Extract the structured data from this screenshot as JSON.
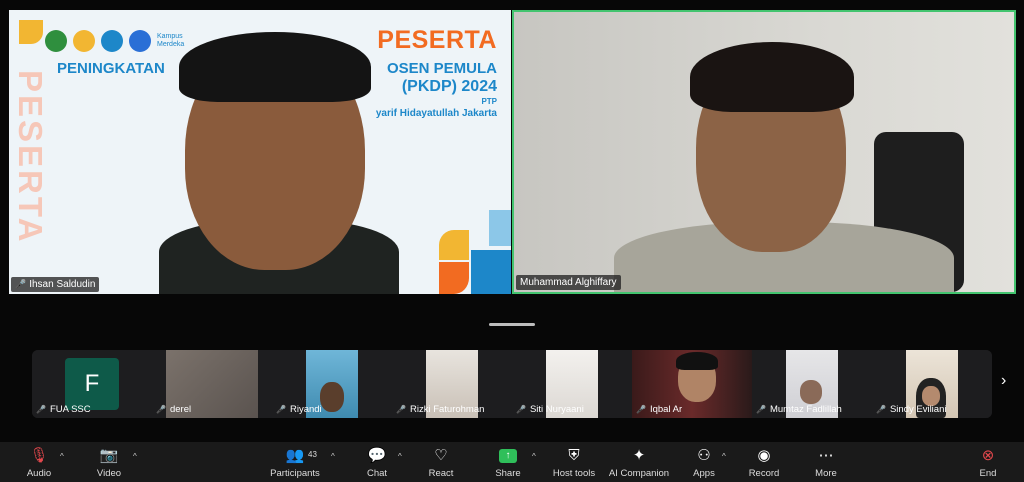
{
  "tiles": [
    {
      "name": "Ihsan Saldudin",
      "muted": true
    },
    {
      "name": "Muhammad Alghiffary",
      "muted": false
    }
  ],
  "slide": {
    "title": "PESERTA",
    "line1": "PENINGKATAN",
    "line1b": "OSEN PEMULA",
    "line2": "(PKDP) 2024",
    "line3": "PTP",
    "line4": "yarif Hidayatullah Jakarta",
    "vertical": "PESERTA",
    "logo_text": "Kampus Merdeka"
  },
  "thumbnails": [
    {
      "name": "FUA SSC",
      "avatar_letter": "F"
    },
    {
      "name": "derel"
    },
    {
      "name": "Riyandi"
    },
    {
      "name": "Rizki Faturohman"
    },
    {
      "name": "Siti Nuryaani"
    },
    {
      "name": "Iqbal Ar"
    },
    {
      "name": "Mumtaz Fadlillah"
    },
    {
      "name": "Sindy Eviliani"
    }
  ],
  "toolbar": {
    "audio": "Audio",
    "video": "Video",
    "participants": "Participants",
    "participants_count": "43",
    "chat": "Chat",
    "react": "React",
    "share": "Share",
    "host_tools": "Host tools",
    "ai_companion": "AI Companion",
    "apps": "Apps",
    "record": "Record",
    "more": "More",
    "end": "End"
  },
  "colors": {
    "active_speaker_border": "#43c46f",
    "muted_red": "#e5484d",
    "share_green": "#2fbf5a",
    "slide_orange": "#f26b21",
    "slide_blue": "#1d87c9"
  }
}
